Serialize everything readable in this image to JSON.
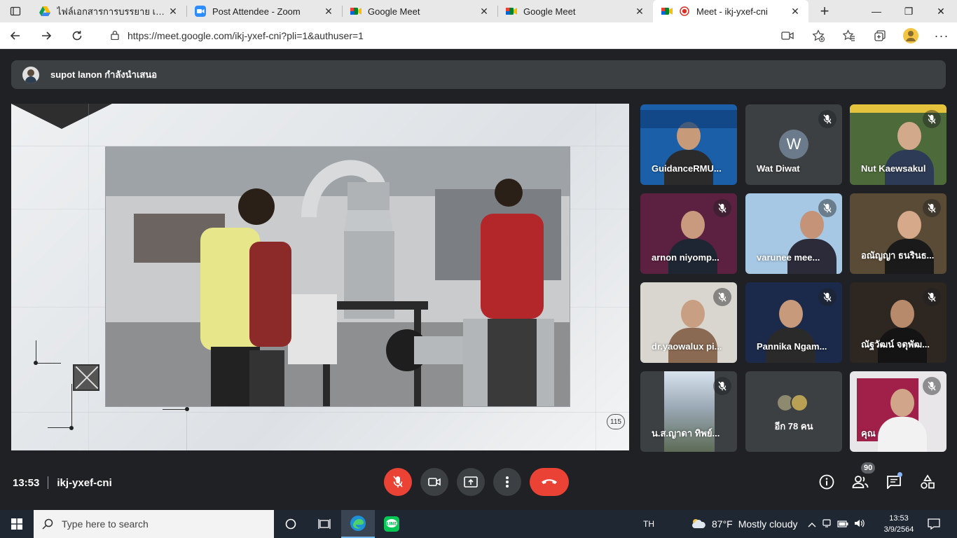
{
  "browser": {
    "tabs": [
      {
        "title": "ไฟล์เอกสารการบรรยาย เทคนิคการ",
        "icon": "google-drive-icon",
        "active": false
      },
      {
        "title": "Post Attendee - Zoom",
        "icon": "zoom-icon",
        "active": false
      },
      {
        "title": "Google Meet",
        "icon": "google-meet-icon",
        "active": false
      },
      {
        "title": "Google Meet",
        "icon": "google-meet-icon",
        "active": false
      },
      {
        "title": "Meet - ikj-yxef-cni",
        "icon": "recording-icon",
        "active": true
      }
    ],
    "url": "https://meet.google.com/ikj-yxef-cni?pli=1&authuser=1"
  },
  "presenter": {
    "label": "supot lanon กำลังนำเสนอ"
  },
  "stage": {
    "page_number": "115"
  },
  "participants": [
    {
      "name": "GuidanceRMU...",
      "muted": false
    },
    {
      "name": "Wat Diwat",
      "muted": true,
      "initial": "W"
    },
    {
      "name": "Nut Kaewsakul",
      "muted": true
    },
    {
      "name": "arnon niyomp...",
      "muted": true
    },
    {
      "name": "varunee mee...",
      "muted": true
    },
    {
      "name": "อณัญญา ธนรินธ...",
      "muted": true
    },
    {
      "name": "dr.yaowalux pi...",
      "muted": true
    },
    {
      "name": "Pannika Ngam...",
      "muted": true
    },
    {
      "name": "ณัฐวัฒน์ จตุพัฒ...",
      "muted": true
    },
    {
      "name": "น.ส.ญาดา ทิพย์...",
      "muted": true
    },
    {
      "name": "คุณ",
      "muted": true
    }
  ],
  "more_participants": "อีก 78 คน",
  "meeting": {
    "time": "13:53",
    "code": "ikj-yxef-cni",
    "participant_count": "90"
  },
  "taskbar": {
    "search_placeholder": "Type here to search",
    "language": "TH",
    "weather_temp": "87°F",
    "weather_desc": "Mostly cloudy",
    "clock_time": "13:53",
    "clock_date": "3/9/2564"
  },
  "colors": {
    "meet_bg": "#202124",
    "tile_bg": "#3c4043",
    "danger_red": "#ea4335",
    "accent_blue": "#8ab4f8"
  }
}
